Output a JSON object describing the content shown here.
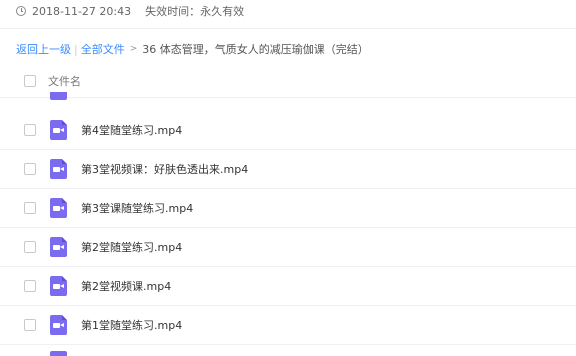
{
  "share_meta": {
    "timestamp": "2018-11-27 20:43",
    "expiry": "失效时间：永久有效"
  },
  "breadcrumb": {
    "back_label": "返回上一级",
    "separator": "|",
    "all_files_label": "全部文件",
    "arrow": ">",
    "current_folder": "36 体态管理，气质女人的减压瑜伽课（完结）"
  },
  "table": {
    "column_header": "文件名"
  },
  "files": [
    {
      "name": "第4堂随堂练习.mp4",
      "icon": "video-file-icon"
    },
    {
      "name": "第3堂视频课：好肤色透出来.mp4",
      "icon": "video-file-icon"
    },
    {
      "name": "第3堂课随堂练习.mp4",
      "icon": "video-file-icon"
    },
    {
      "name": "第2堂随堂练习.mp4",
      "icon": "video-file-icon"
    },
    {
      "name": "第2堂视频课.mp4",
      "icon": "video-file-icon"
    },
    {
      "name": "第1堂随堂练习.mp4",
      "icon": "video-file-icon"
    }
  ],
  "colors": {
    "accent": "#3b8cff",
    "video_icon": "#7b6bf0"
  }
}
